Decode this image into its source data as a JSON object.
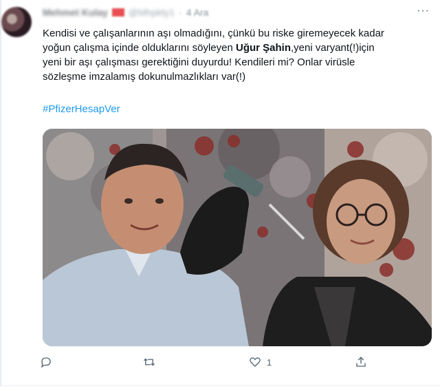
{
  "tweet": {
    "author_name": "Mehmet Kulay",
    "author_handle": "@Mhpkty1",
    "separator": "·",
    "time": "4 Ara",
    "more_label": "···",
    "text_lines": [
      {
        "before": "Kendisi ve çalışanlarının aşı olmadığını, çünkü bu riske giremeyecek kadar",
        "bold": "",
        "after": ""
      },
      {
        "before": "yoğun çalışma içinde olduklarını söyleyen ",
        "bold": "Uğur Şahin",
        "after": ",yeni varyant(!)için"
      },
      {
        "before": "yeni bir aşı çalışması gerektiğini duyurdu! Kendileri mi? Onlar virüsle",
        "bold": "",
        "after": ""
      },
      {
        "before": "sözleşme imzalamış dokunulmazlıkları var(!)",
        "bold": "",
        "after": ""
      }
    ],
    "hashtag": "#PfizerHesapVer",
    "media_icon": "photo-of-two-people-with-vaccine-syringe",
    "actions": {
      "reply": {
        "icon": "reply-icon",
        "count": ""
      },
      "retweet": {
        "icon": "retweet-icon",
        "count": ""
      },
      "like": {
        "icon": "heart-icon",
        "count": "1"
      },
      "share": {
        "icon": "share-icon",
        "count": ""
      }
    }
  },
  "colors": {
    "link": "#1d9bf0",
    "muted": "#536471",
    "text": "#0f1419"
  }
}
